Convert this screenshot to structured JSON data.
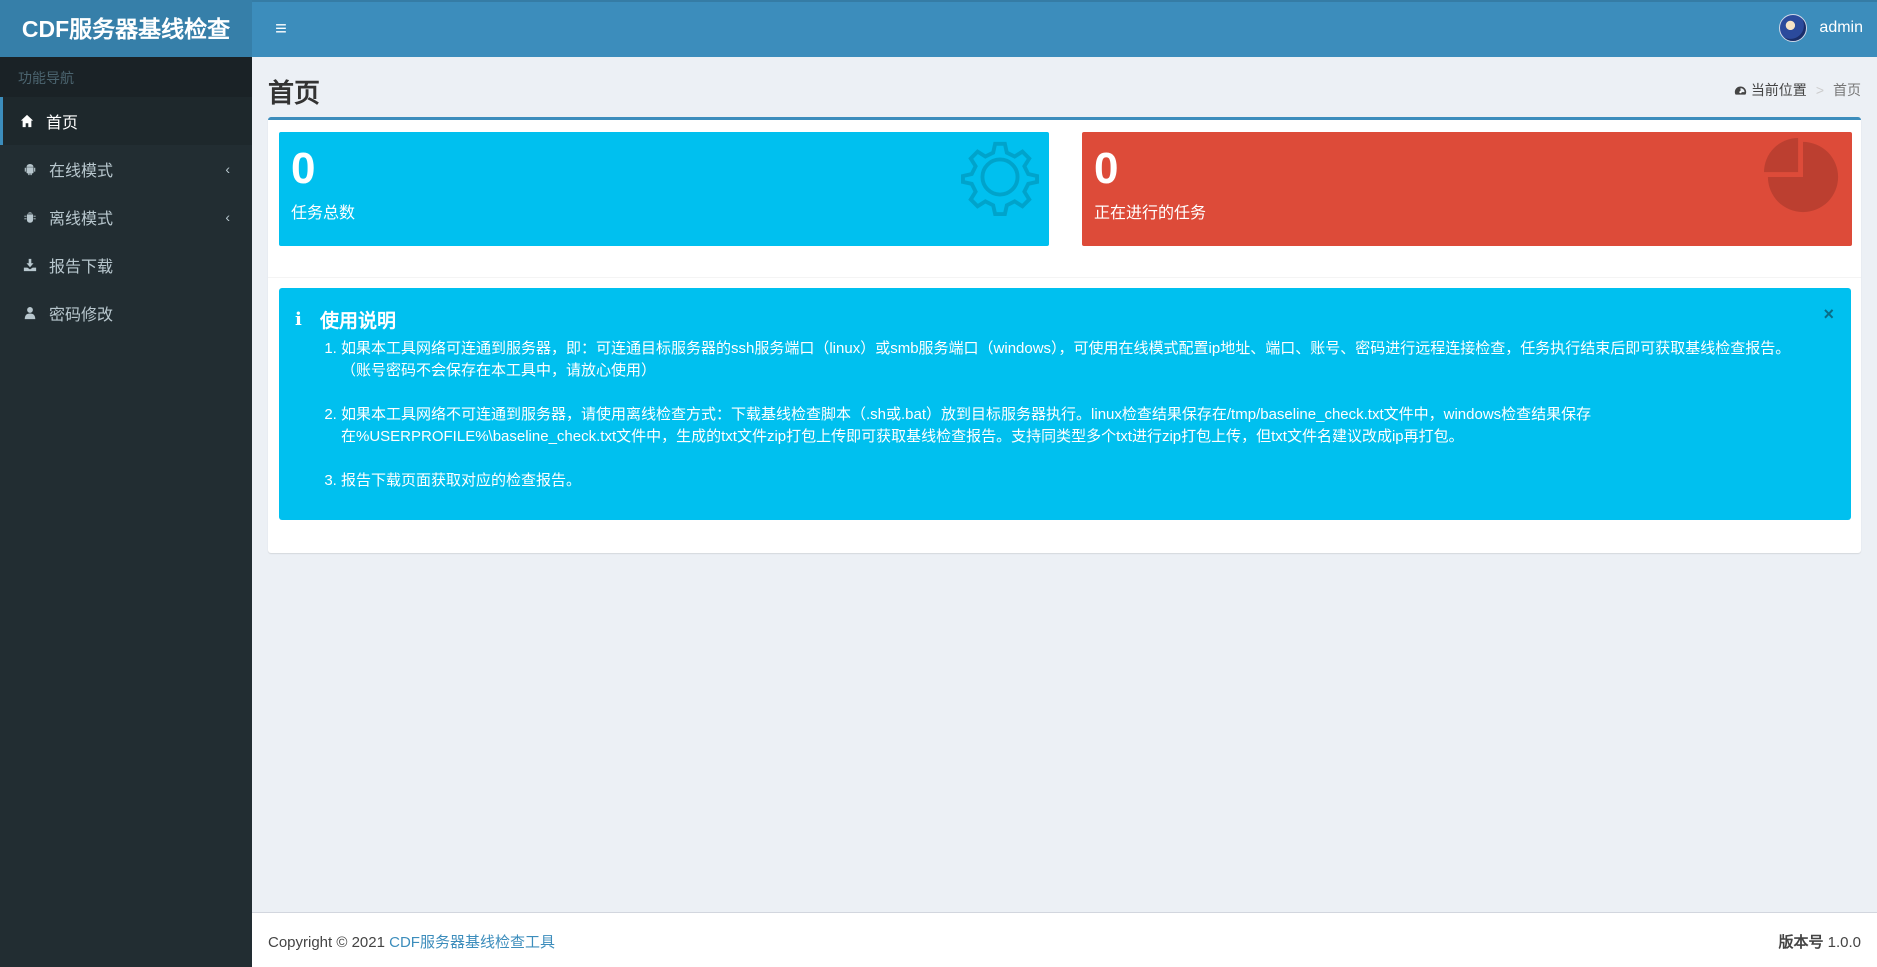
{
  "header": {
    "logo": "CDF服务器基线检查",
    "toggle_icon": "≡",
    "username": "admin"
  },
  "sidebar": {
    "heading": "功能导航",
    "items": [
      {
        "label": "首页",
        "icon": "home-icon"
      },
      {
        "label": "在线模式",
        "icon": "android-icon"
      },
      {
        "label": "离线模式",
        "icon": "bug-icon"
      },
      {
        "label": "报告下载",
        "icon": "download-icon"
      },
      {
        "label": "密码修改",
        "icon": "user-icon"
      }
    ]
  },
  "page": {
    "title": "首页",
    "breadcrumb": {
      "root": "当前位置",
      "sep": ">",
      "current": "首页"
    }
  },
  "stats": [
    {
      "value": "0",
      "label": "任务总数",
      "color": "#00c0ef",
      "icon": "gear-icon"
    },
    {
      "value": "0",
      "label": "正在进行的任务",
      "color": "#dd4b39",
      "icon": "pie-chart-icon"
    }
  ],
  "callout": {
    "icon": "i",
    "title": "使用说明",
    "close": "×",
    "items": [
      "如果本工具网络可连通到服务器，即：可连通目标服务器的ssh服务端口（linux）或smb服务端口（windows），可使用在线模式配置ip地址、端口、账号、密码进行远程连接检查，任务执行结束后即可获取基线检查报告。（账号密码不会保存在本工具中，请放心使用）",
      "如果本工具网络不可连通到服务器，请使用离线检查方式：下载基线检查脚本（.sh或.bat）放到目标服务器执行。linux检查结果保存在/tmp/baseline_check.txt文件中，windows检查结果保存在%USERPROFILE%\\baseline_check.txt文件中，生成的txt文件zip打包上传即可获取基线检查报告。支持同类型多个txt进行zip打包上传，但txt文件名建议改成ip再打包。",
      "报告下载页面获取对应的检查报告。"
    ]
  },
  "footer": {
    "copyright": "Copyright © 2021",
    "link": "CDF服务器基线检查工具",
    "version_label": "版本号",
    "version": "1.0.0"
  },
  "colors": {
    "primary": "#3c8dbc",
    "sidebar": "#222d32",
    "aqua": "#00c0ef",
    "red": "#dd4b39"
  }
}
